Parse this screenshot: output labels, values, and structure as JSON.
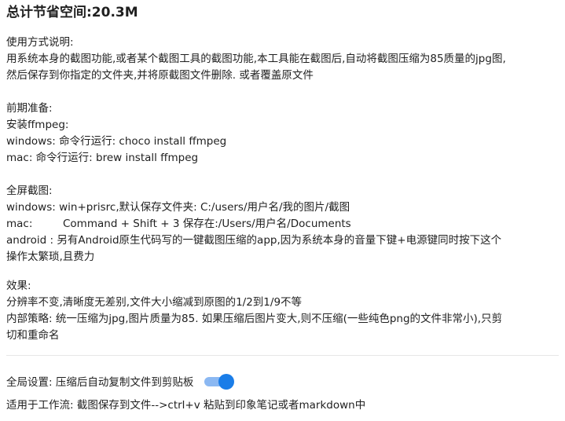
{
  "title": "总计节省空间:20.3M",
  "usage": {
    "heading": "使用方式说明:",
    "line1": "用系统本身的截图功能,或者某个截图工具的截图功能,本工具能在截图后,自动将截图压缩为85质量的jpg图,",
    "line2": "然后保存到你指定的文件夹,并将原截图文件删除. 或者覆盖原文件"
  },
  "prep": {
    "heading": "前期准备:",
    "install": "安装ffmpeg:",
    "windows": "windows: 命令行运行: choco install ffmpeg",
    "mac": "mac: 命令行运行: brew install ffmpeg"
  },
  "screenshot": {
    "heading": "全屏截图:",
    "windows": "windows:  win+prisrc,默认保存文件夹: C:/users/用户名/我的图片/截图",
    "mac_label": "mac:",
    "mac_value": "Command + Shift + 3 保存在:/Users/用户名/Documents",
    "android_line1": "android : 另有Android原生代码写的一键截图压缩的app,因为系统本身的音量下键+电源键同时按下这个",
    "android_line2": "操作太繁琐,且费力"
  },
  "effect": {
    "heading": "效果:",
    "line1": "分辨率不变,清晰度无差别,文件大小缩减到原图的1/2到1/9不等",
    "line2": "内部策略: 统一压缩为jpg,图片质量为85. 如果压缩后图片变大,则不压缩(一些纯色png的文件非常小),只剪",
    "line3": "切和重命名"
  },
  "settings": {
    "auto_copy_label": "全局设置: 压缩后自动复制文件到剪贴板",
    "auto_copy_enabled": true,
    "toggle_color": "#1a7de8"
  },
  "workflow": "适用于工作流:  截图保存到文件-->ctrl+v 粘贴到印象笔记或者markdown中"
}
